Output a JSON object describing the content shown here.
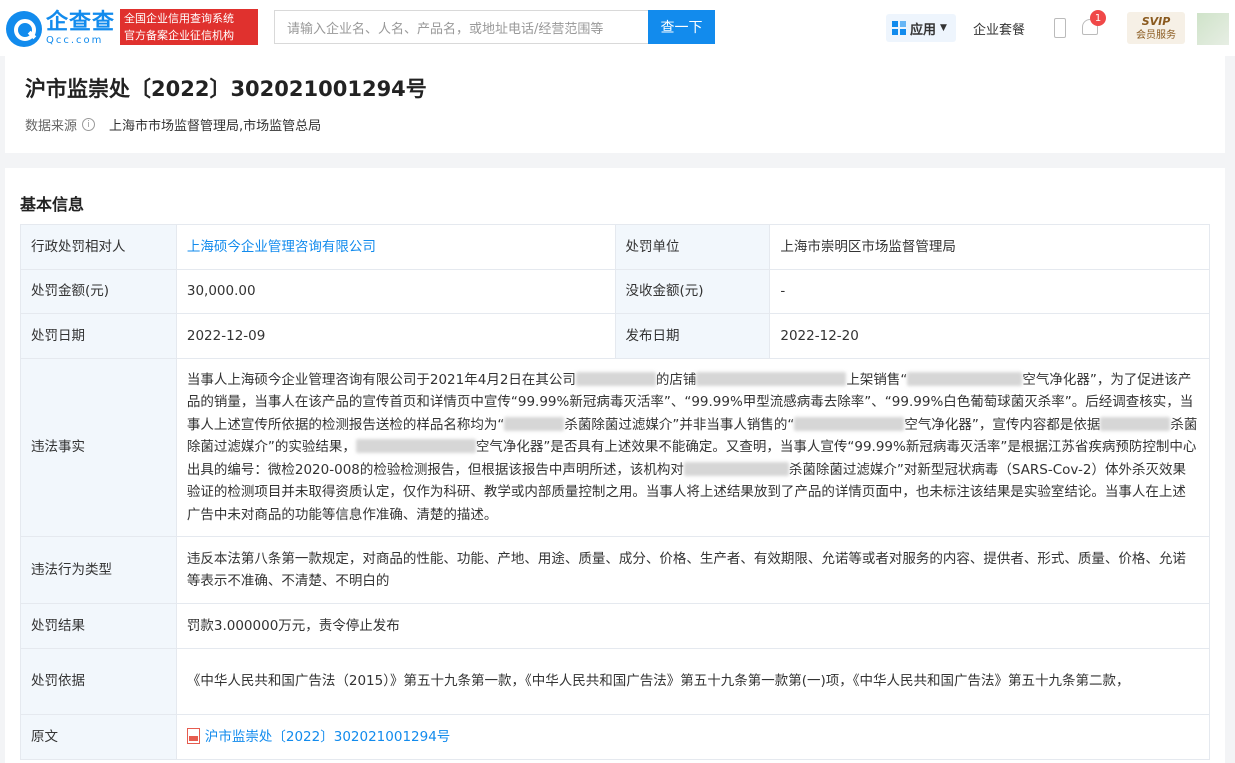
{
  "header": {
    "logo_cn": "企查查",
    "logo_en": "Qcc.com",
    "badge_line1": "全国企业信用查询系统",
    "badge_line2": "官方备案企业征信机构",
    "search_placeholder": "请输入企业名、人名、产品名，或地址电话/经营范围等",
    "search_button": "查一下",
    "app_label": "应用",
    "suite_label": "企业套餐",
    "notification_count": "1",
    "svip_label": "SVIP",
    "svip_sub": "会员服务"
  },
  "title_card": {
    "title": "沪市监崇处〔2022〕302021001294号",
    "source_label": "数据来源",
    "source_value": "上海市市场监督管理局,市场监管总局"
  },
  "section": {
    "title": "基本信息"
  },
  "info": {
    "party_label": "行政处罚相对人",
    "party_value": "上海硕今企业管理咨询有限公司",
    "unit_label": "处罚单位",
    "unit_value": "上海市崇明区市场监督管理局",
    "amount_label": "处罚金额(元)",
    "amount_value": "30,000.00",
    "confiscate_label": "没收金额(元)",
    "confiscate_value": "-",
    "date_label": "处罚日期",
    "date_value": "2022-12-09",
    "publish_label": "发布日期",
    "publish_value": "2022-12-20",
    "facts_label": "违法事实",
    "facts_p1": "当事人上海硕今企业管理咨询有限公司于2021年4月2日在其公司",
    "facts_p2": "的店铺",
    "facts_p3": "上架销售“",
    "facts_p4": "空气净化器”，为了促进该产品的销量，当事人在该产品的宣传首页和详情页中宣传“99.99%新冠病毒灭活率”、“99.99%甲型流感病毒去除率”、“99.99%白色葡萄球菌灭杀率”。后经调查核实，当事人上述宣传所依据的检测报告送检的样品名称均为“",
    "facts_p5": "杀菌除菌过滤媒介”并非当事人销售的“",
    "facts_p6": "空气净化器”，宣传内容都是依据",
    "facts_p7": "杀菌除菌过滤媒介”的实验结果，",
    "facts_p8": "空气净化器”是否具有上述效果不能确定。又查明，当事人宣传“99.99%新冠病毒灭活率”是根据江苏省疾病预防控制中心出具的编号：微检2020-008的检验检测报告，但根据该报告中声明所述，该机构对",
    "facts_p9": "杀菌除菌过滤媒介”对新型冠状病毒（SARS-Cov-2）体外杀灭效果验证的检测项目并未取得资质认定，仅作为科研、教学或内部质量控制之用。当事人将上述结果放到了产品的详情页面中，也未标注该结果是实验室结论。当事人在上述广告中未对商品的功能等信息作准确、清楚的描述。",
    "type_label": "违法行为类型",
    "type_value": "违反本法第八条第一款规定，对商品的性能、功能、产地、用途、质量、成分、价格、生产者、有效期限、允诺等或者对服务的内容、提供者、形式、质量、价格、允诺等表示不准确、不清楚、不明白的",
    "result_label": "处罚结果",
    "result_value": "罚款3.000000万元，责令停止发布",
    "basis_label": "处罚依据",
    "basis_value": "《中华人民共和国广告法（2015）》第五十九条第一款，《中华人民共和国广告法》第五十九条第一款第(一)项，《中华人民共和国广告法》第五十九条第二款，",
    "original_label": "原文",
    "original_value": "沪市监崇处〔2022〕302021001294号"
  }
}
